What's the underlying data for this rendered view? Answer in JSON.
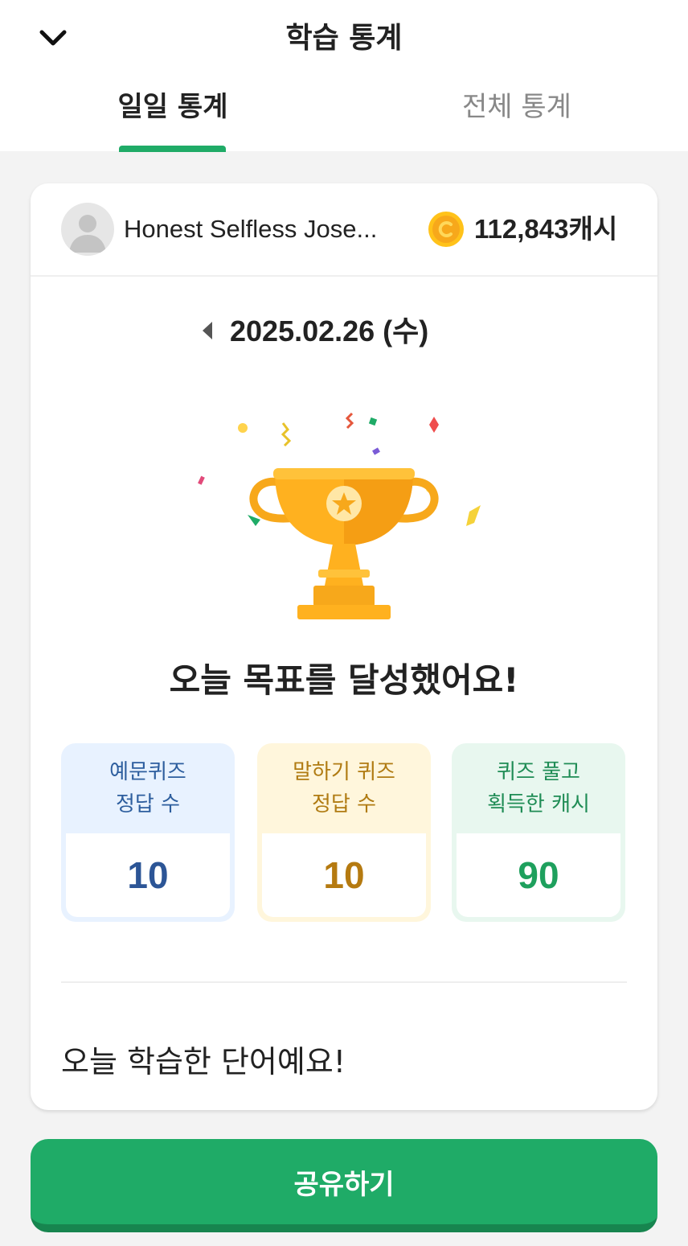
{
  "header": {
    "title": "학습 통계",
    "back_icon": "chevron-down-icon"
  },
  "tabs": [
    {
      "label": "일일 통계",
      "active": true
    },
    {
      "label": "전체 통계",
      "active": false
    }
  ],
  "profile": {
    "nickname": "Honest Selfless Jose...",
    "cash": "112,843캐시",
    "coin_icon": "coin-icon"
  },
  "date": {
    "label": "2025.02.26 (수)",
    "prev_icon": "caret-left-icon"
  },
  "goal_message": "오늘 목표를 달성했어요!",
  "stats": [
    {
      "line1": "예문퀴즈",
      "line2": "정답 수",
      "value": "10",
      "color": "#2c5596"
    },
    {
      "line1": "말하기 퀴즈",
      "line2": "정답 수",
      "value": "10",
      "color": "#b57a10"
    },
    {
      "line1": "퀴즈 풀고",
      "line2": "획득한 캐시",
      "value": "90",
      "color": "#1ea05d"
    }
  ],
  "words_title": "오늘 학습한 단어예요!",
  "share_button": "공유하기",
  "colors": {
    "accent": "#1fab67",
    "gold": "#f7a81b"
  }
}
